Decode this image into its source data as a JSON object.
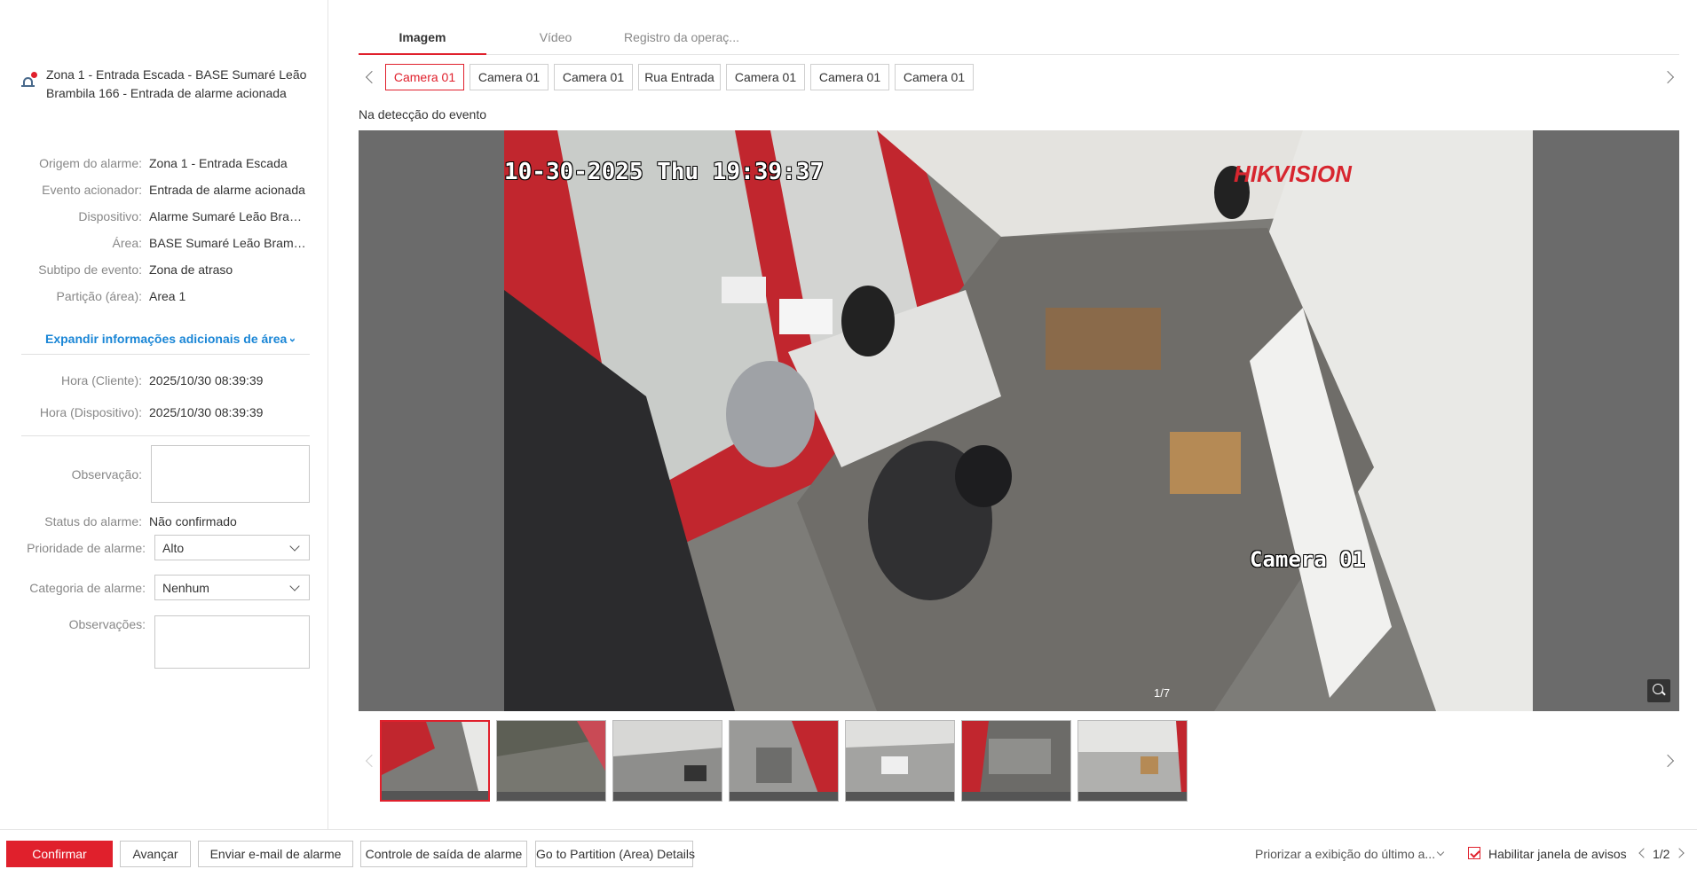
{
  "alarm": {
    "title": "Zona 1 - Entrada Escada - BASE Sumaré Leão Brambila 166 - Entrada de alarme acionada",
    "icon": "alarm-device-icon"
  },
  "details": [
    {
      "label": "Origem do alarme:",
      "value": "Zona 1 - Entrada Escada"
    },
    {
      "label": "Evento acionador:",
      "value": "Entrada de alarme acionada"
    },
    {
      "label": "Dispositivo:",
      "value": "Alarme Sumaré Leão Bram..."
    },
    {
      "label": "Área:",
      "value": "BASE Sumaré Leão Brambil..."
    },
    {
      "label": "Subtipo de evento:",
      "value": "Zona de atraso"
    },
    {
      "label": "Partição (área):",
      "value": "Area 1"
    }
  ],
  "expand_label": "Expandir informações adicionais de área",
  "times": [
    {
      "label": "Hora (Cliente):",
      "value": "2025/10/30 08:39:39"
    },
    {
      "label": "Hora (Dispositivo):",
      "value": "2025/10/30 08:39:39"
    }
  ],
  "form": {
    "observacao_label": "Observação:",
    "observacao_value": "",
    "status_label": "Status do alarme:",
    "status_value": "Não confirmado",
    "prioridade_label": "Prioridade de alarme:",
    "prioridade_value": "Alto",
    "categoria_label": "Categoria de alarme:",
    "categoria_value": "Nenhum",
    "observacoes_label": "Observações:",
    "observacoes_value": ""
  },
  "tabs": [
    {
      "label": "Imagem",
      "active": true
    },
    {
      "label": "Vídeo",
      "active": false
    },
    {
      "label": "Registro da operaç...",
      "active": false
    }
  ],
  "cameras": [
    "Camera 01",
    "Camera 01",
    "Camera 01",
    "Rua Entrada",
    "Camera 01",
    "Camera 01",
    "Camera 01"
  ],
  "event_label": "Na detecção do evento",
  "viewer": {
    "osd_time": "10-30-2025 Thu 19:39:37",
    "osd_brand": "HIKVISION",
    "osd_camera": "Camera 01",
    "counter": "1/7"
  },
  "bottom": {
    "confirm": "Confirmar",
    "next": "Avançar",
    "email": "Enviar e-mail de alarme",
    "output": "Controle de saída de alarme",
    "partition": "Go to Partition (Area) Details",
    "priority_view": "Priorizar a exibição do último a...",
    "enable_popup": "Habilitar janela de avisos",
    "page": "1/2"
  },
  "colors": {
    "accent": "#e0202c",
    "link": "#1a86d6"
  }
}
